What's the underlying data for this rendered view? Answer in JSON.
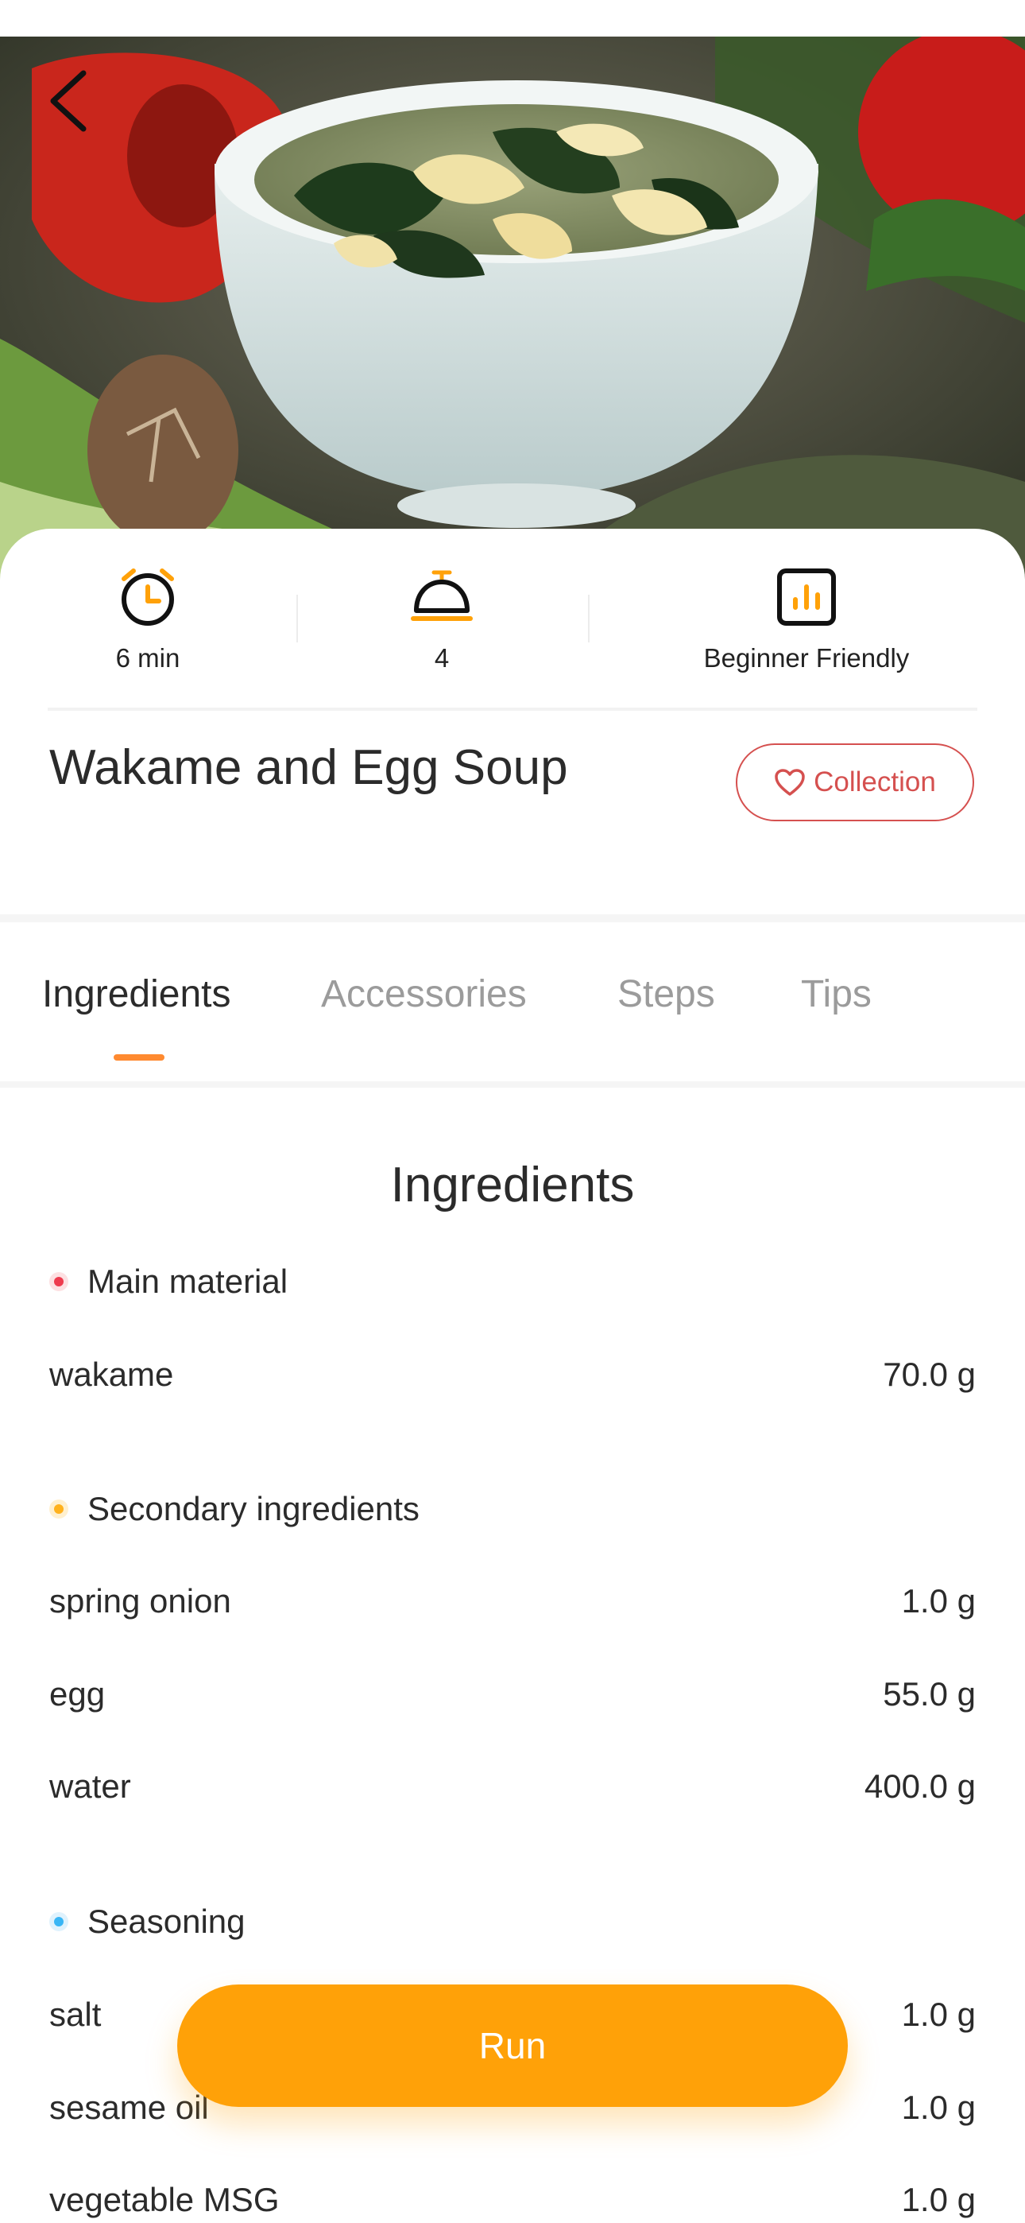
{
  "recipe": {
    "title": "Wakame and Egg Soup",
    "collection_label": "Collection"
  },
  "stats": [
    {
      "icon": "alarm-clock-icon",
      "label": "6 min"
    },
    {
      "icon": "serving-bell-icon",
      "label": "4"
    },
    {
      "icon": "difficulty-chart-icon",
      "label": "Beginner Friendly"
    }
  ],
  "tabs": [
    {
      "label": "Ingredients",
      "active": true
    },
    {
      "label": "Accessories",
      "active": false
    },
    {
      "label": "Steps",
      "active": false
    },
    {
      "label": "Tips",
      "active": false
    }
  ],
  "ingredients": {
    "heading": "Ingredients",
    "groups": [
      {
        "name": "Main material",
        "color": "#ee3b4e",
        "items": [
          {
            "name": "wakame",
            "amount": "70.0 g"
          }
        ]
      },
      {
        "name": "Secondary ingredients",
        "color": "#ffb21e",
        "items": [
          {
            "name": "spring onion",
            "amount": "1.0 g"
          },
          {
            "name": "egg",
            "amount": "55.0 g"
          },
          {
            "name": "water",
            "amount": "400.0 g"
          }
        ]
      },
      {
        "name": "Seasoning",
        "color": "#39b6f5",
        "items": [
          {
            "name": "salt",
            "amount": "1.0 g"
          },
          {
            "name": "sesame oil",
            "amount": "1.0 g"
          },
          {
            "name": "vegetable MSG",
            "amount": "1.0 g"
          }
        ]
      }
    ]
  },
  "run_button": {
    "label": "Run"
  },
  "colors": {
    "accent": "#ffa108",
    "tab_indicator": "#ff8a30",
    "collection": "#d5504f"
  }
}
